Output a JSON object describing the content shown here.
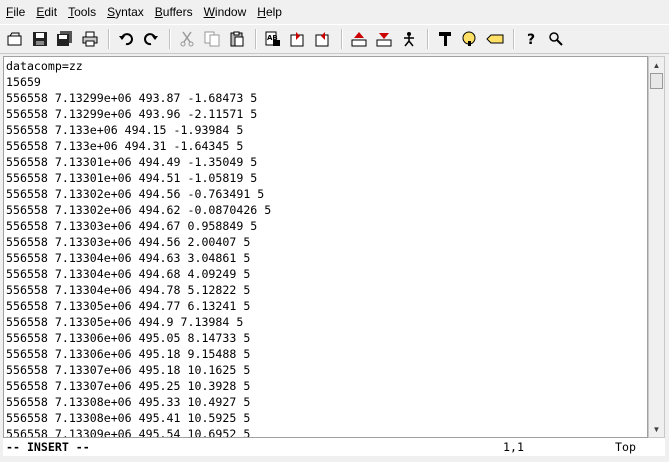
{
  "menubar": {
    "items": [
      {
        "acc": "F",
        "rest": "ile"
      },
      {
        "acc": "E",
        "rest": "dit"
      },
      {
        "acc": "T",
        "rest": "ools"
      },
      {
        "acc": "S",
        "rest": "yntax"
      },
      {
        "acc": "B",
        "rest": "uffers"
      },
      {
        "acc": "W",
        "rest": "indow"
      },
      {
        "acc": "H",
        "rest": "elp"
      }
    ]
  },
  "toolbar": {
    "icons": [
      "open-icon",
      "save-icon",
      "save-all-icon",
      "print-icon",
      "undo-icon",
      "redo-icon",
      "cut-icon",
      "copy-icon",
      "paste-icon",
      "find-replace-icon",
      "find-next-icon",
      "find-previous-icon",
      "load-session-icon",
      "save-session-icon",
      "run-script-icon",
      "make-icon",
      "shell-icon",
      "tag-jump-icon",
      "help-icon",
      "find-help-icon"
    ]
  },
  "editor": {
    "lines": [
      "datacomp=zz",
      "15659",
      "556558 7.13299e+06 493.87 -1.68473 5",
      "556558 7.13299e+06 493.96 -2.11571 5",
      "556558 7.133e+06 494.15 -1.93984 5",
      "556558 7.133e+06 494.31 -1.64345 5",
      "556558 7.13301e+06 494.49 -1.35049 5",
      "556558 7.13301e+06 494.51 -1.05819 5",
      "556558 7.13302e+06 494.56 -0.763491 5",
      "556558 7.13302e+06 494.62 -0.0870426 5",
      "556558 7.13303e+06 494.67 0.958849 5",
      "556558 7.13303e+06 494.56 2.00407 5",
      "556558 7.13304e+06 494.63 3.04861 5",
      "556558 7.13304e+06 494.68 4.09249 5",
      "556558 7.13304e+06 494.78 5.12822 5",
      "556558 7.13305e+06 494.77 6.13241 5",
      "556558 7.13305e+06 494.9 7.13984 5",
      "556558 7.13306e+06 495.05 8.14733 5",
      "556558 7.13306e+06 495.18 9.15488 5",
      "556558 7.13307e+06 495.18 10.1625 5",
      "556558 7.13307e+06 495.25 10.3928 5",
      "556558 7.13308e+06 495.33 10.4927 5",
      "556558 7.13308e+06 495.41 10.5925 5",
      "556558 7.13309e+06 495.54 10.6952 5"
    ]
  },
  "status": {
    "mode": "-- INSERT --",
    "position": "1,1",
    "scroll": "Top"
  }
}
